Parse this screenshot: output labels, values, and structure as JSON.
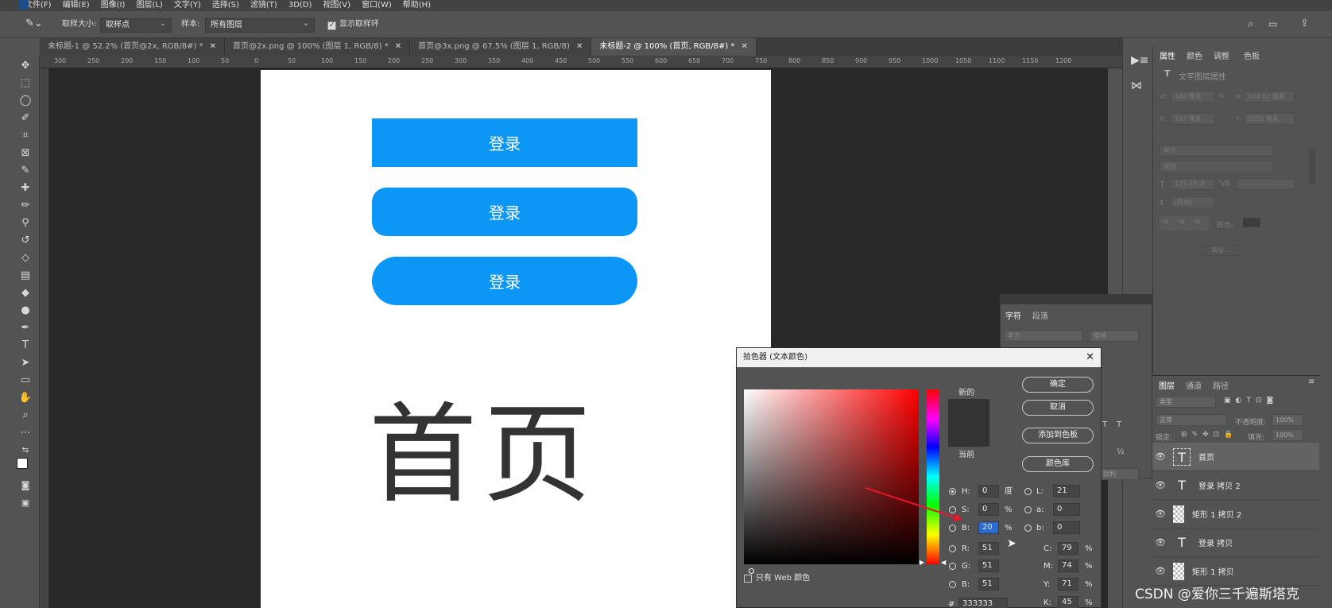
{
  "menu": {
    "items": [
      "文件(F)",
      "编辑(E)",
      "图像(I)",
      "图层(L)",
      "文字(Y)",
      "选择(S)",
      "滤镜(T)",
      "3D(D)",
      "视图(V)",
      "窗口(W)",
      "帮助(H)"
    ]
  },
  "options": {
    "sample_size_label": "取样大小:",
    "sample_size_value": "取样点",
    "sample_label": "样本:",
    "sample_value": "所有图层",
    "show_ring_label": "显示取样环"
  },
  "tabs": [
    {
      "label": "未标题-1 @ 52.2% (首页@2x, RGB/8#) *"
    },
    {
      "label": "首页@2x.png @ 100% (图层 1, RGB/8) *"
    },
    {
      "label": "首页@3x.png @ 67.5% (图层 1, RGB/8)"
    },
    {
      "label": "未标题-2 @ 100% (首页, RGB/8#) *"
    }
  ],
  "ruler": {
    "ticks": [
      "300",
      "250",
      "200",
      "150",
      "100",
      "50",
      "0",
      "50",
      "100",
      "150",
      "200",
      "250",
      "300",
      "350",
      "400",
      "450",
      "500",
      "550",
      "600",
      "650",
      "700",
      "750",
      "800",
      "850",
      "900",
      "950",
      "1000",
      "1050",
      "1100",
      "1150",
      "1200"
    ]
  },
  "canvas": {
    "buttons": [
      "登录",
      "登录",
      "登录"
    ],
    "button_color": "#0c96f6",
    "home_text": "首页",
    "home_text_color": "#333333"
  },
  "properties": {
    "tabs": [
      "属性",
      "颜色",
      "调整",
      "色板"
    ],
    "title": "文字图层属性",
    "w_label": "W:",
    "w_value": "340 像素",
    "h_label": "H:",
    "h_value": "194.62 像素",
    "x_label": "X:",
    "x_value": "163 像素",
    "y_label": "Y:",
    "y_value": "1051 像素",
    "font_family": "苹方",
    "font_style": "常规",
    "font_size": "175.49 点",
    "leading": "(自动)",
    "color_label": "颜色:",
    "advanced": "高级..."
  },
  "character_panel": {
    "tabs": [
      "字符",
      "段落"
    ],
    "font_family": "苹方",
    "font_style": "常规",
    "sharp": "锐利"
  },
  "layers": {
    "tabs": [
      "图层",
      "通道",
      "路径"
    ],
    "filter": "类型",
    "blend_mode": "正常",
    "opacity_label": "不透明度:",
    "opacity": "100%",
    "lock_label": "锁定:",
    "fill_label": "填充:",
    "fill": "100%",
    "items": [
      {
        "name": "首页",
        "type": "text"
      },
      {
        "name": "登录 拷贝 2",
        "type": "text"
      },
      {
        "name": "矩形 1 拷贝 2",
        "type": "shape"
      },
      {
        "name": "登录 拷贝",
        "type": "text"
      },
      {
        "name": "矩形 1 拷贝",
        "type": "shape"
      }
    ]
  },
  "color_picker": {
    "title": "拾色器 (文本颜色)",
    "new_label": "新的",
    "current_label": "当前",
    "ok": "确定",
    "cancel": "取消",
    "add_swatch": "添加到色板",
    "color_library": "颜色库",
    "web_only_label": "只有 Web 颜色",
    "H": "0",
    "H_unit": "度",
    "S": "0",
    "S_unit": "%",
    "B": "20",
    "B_unit": "%",
    "R": "51",
    "G": "51",
    "Bv": "51",
    "L": "21",
    "a": "0",
    "b": "0",
    "C": "79",
    "M": "74",
    "Y": "71",
    "K": "45",
    "pct": "%",
    "hex": "333333",
    "swatch_color": "#333333"
  },
  "watermark": "CSDN @爱你三千遍斯塔克"
}
